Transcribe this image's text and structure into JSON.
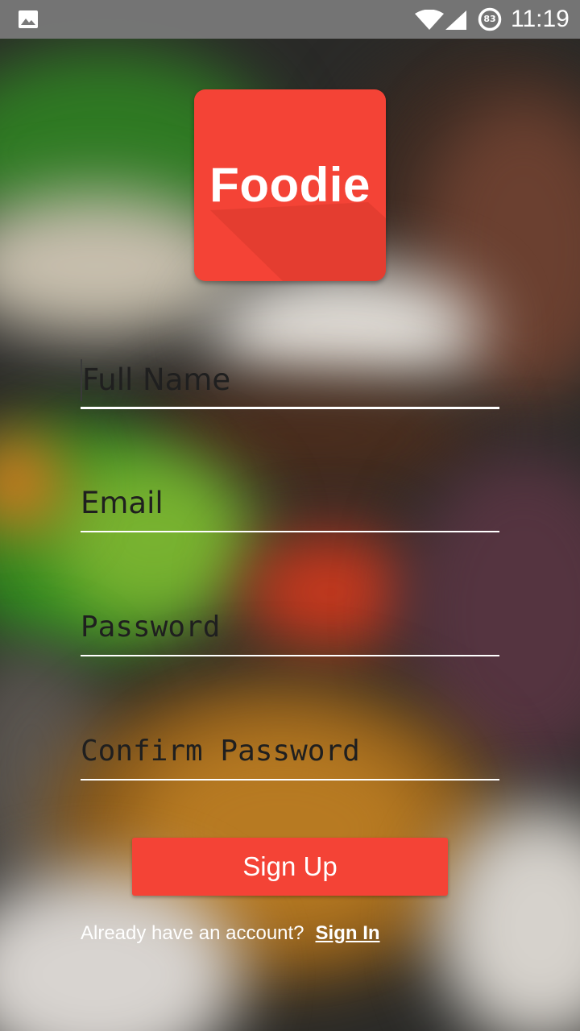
{
  "status_bar": {
    "time": "11:19",
    "battery_level": "83",
    "icons": [
      "gallery-icon",
      "wifi-icon",
      "signal-icon",
      "battery-icon"
    ]
  },
  "logo": {
    "text": "Foodie",
    "color": "#f44336"
  },
  "form": {
    "full_name": {
      "placeholder": "Full Name",
      "value": ""
    },
    "email": {
      "placeholder": "Email",
      "value": ""
    },
    "password": {
      "placeholder": "Password",
      "value": ""
    },
    "confirm_password": {
      "placeholder": "Confirm Password",
      "value": ""
    }
  },
  "signup_button": {
    "label": "Sign Up",
    "color": "#f44336"
  },
  "signin": {
    "prompt": "Already have an account?",
    "link_label": "Sign In"
  }
}
